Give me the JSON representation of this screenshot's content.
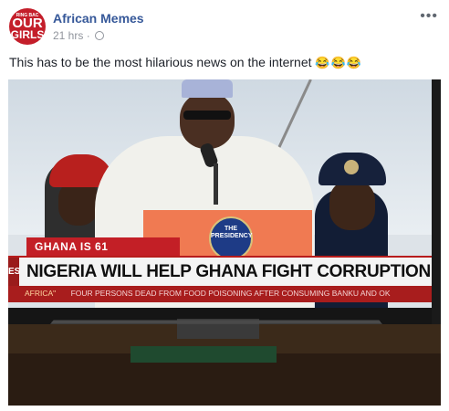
{
  "post": {
    "page_name": "African Memes",
    "time": "21 hrs",
    "separator": "·",
    "more_label": "•••",
    "caption": "This has to be the most hilarious news on the internet",
    "caption_emoji": "😂😂😂"
  },
  "avatar": {
    "line1": "RING BAC",
    "line2": "OUR",
    "line3": "GIRLS"
  },
  "broadcast": {
    "seal_text": "THE PRESIDENCY",
    "tag": "GHANA IS 61",
    "headline": "NIGERIA WILL HELP GHANA FIGHT CORRUPTION - BUHARI",
    "headline_left": "ES",
    "ticker_region": "AFRICA\"",
    "ticker_text": "FOUR PERSONS DEAD FROM FOOD POISONING AFTER CONSUMING BANKU AND OK"
  }
}
